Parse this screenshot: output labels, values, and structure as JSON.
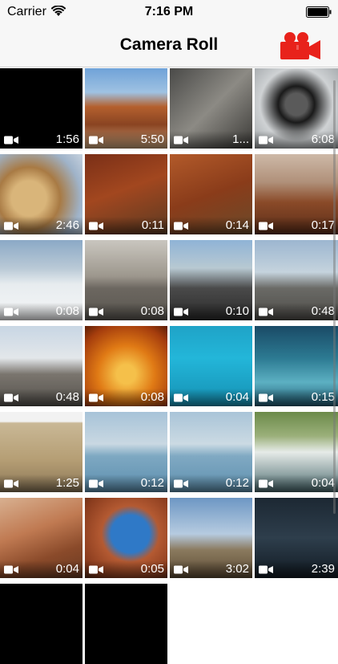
{
  "status_bar": {
    "carrier": "Carrier",
    "time": "7:16 PM"
  },
  "nav": {
    "title": "Camera Roll",
    "accent": "#e8221b"
  },
  "videos": [
    {
      "duration": "1:56",
      "bg": "#000000"
    },
    {
      "duration": "5:50",
      "bg": "linear-gradient(180deg,#6fa2d8 0%,#9fc2e2 30%,#b4602e 48%,#8a4422 70%,#caa27a 100%)"
    },
    {
      "duration": "1...",
      "bg": "linear-gradient(135deg,#4a4a48,#8c8a84 50%,#3a3936)"
    },
    {
      "duration": "6:08",
      "bg": "radial-gradient(circle at 50% 45%,#5a5a5a 0 18%,#1a1a1a 30%,#cfd2d4 60%,#9ea3a6 100%)"
    },
    {
      "duration": "2:46",
      "bg": "radial-gradient(circle at 35% 55%,#d9b57a 0 25%,#a87a44 45%,#9fb3c9 75%,#c6d2df 100%)"
    },
    {
      "duration": "0:11",
      "bg": "linear-gradient(160deg,#7a2f17,#a2471f 45%,#5b3a22 100%)"
    },
    {
      "duration": "0:14",
      "bg": "linear-gradient(160deg,#b25a2a,#8a3c1a 50%,#6a4a2a 100%)"
    },
    {
      "duration": "0:17",
      "bg": "linear-gradient(180deg,#cdb9a8 0%,#b09079 35%,#8a4a28 60%,#5a2c18 100%)"
    },
    {
      "duration": "0:08",
      "bg": "linear-gradient(180deg,#8ba9c6 0%,#b9c9d6 35%,#e7ecef 55%,#f5f6f7 100%)"
    },
    {
      "duration": "0:08",
      "bg": "linear-gradient(180deg,#c9c6bf 0%,#9d978d 45%,#6c6760 60%,#5a5650 100%)"
    },
    {
      "duration": "0:10",
      "bg": "linear-gradient(180deg,#8fb3d6 0%,#b8c9d2 35%,#4a4a4a 60%,#2a2a2a 100%)"
    },
    {
      "duration": "0:48",
      "bg": "linear-gradient(180deg,#9cb6d0 0%,#c5d3dd 40%,#6a6a66 60%,#4e4c48 100%)"
    },
    {
      "duration": "0:48",
      "bg": "linear-gradient(180deg,#c8d6e4 0%,#e3e7ea 40%,#7a756e 60%,#55524d 100%)"
    },
    {
      "duration": "0:08",
      "bg": "radial-gradient(circle at 50% 60%,#f5c04a 0 15%,#e07a15 45%,#a53d0d 80%,#5a1e06 100%)"
    },
    {
      "duration": "0:04",
      "bg": "linear-gradient(180deg,#1fa3c7 0%,#23b6d9 40%,#1590b3 100%)"
    },
    {
      "duration": "0:15",
      "bg": "linear-gradient(180deg,#1a4a66 0%,#2c7a92 40%,#5cb0c2 70%,#1f5a72 100%)"
    },
    {
      "duration": "1:25",
      "bg": "linear-gradient(180deg,#f2f2f2 0%,#f2f2f2 12%,#c9b896 14%,#b59e74 60%,#8a7656 100%)"
    },
    {
      "duration": "0:12",
      "bg": "linear-gradient(180deg,#a7c3d8 0%,#c9d8e2 40%,#7ea8c2 55%,#5c8fae 100%)"
    },
    {
      "duration": "0:12",
      "bg": "linear-gradient(180deg,#a9c4d8 0%,#cbdae3 40%,#80a9c3 55%,#5e90ae 100%)"
    },
    {
      "duration": "0:04",
      "bg": "linear-gradient(180deg,#6b8a4a 0%,#9bb07a 30%,#e6ebe8 50%,#4a6a6e 100%)"
    },
    {
      "duration": "0:04",
      "bg": "linear-gradient(160deg,#d8b090,#c07a52 40%,#8a4a2a 70%,#6a3a22 100%)"
    },
    {
      "duration": "0:05",
      "bg": "radial-gradient(ellipse at 55% 45%,#2f79c7 0 30%,#b45a32 45%,#8a3c1e 80%,#5a2a16 100%)"
    },
    {
      "duration": "3:02",
      "bg": "linear-gradient(180deg,#6d97c4 0%,#b6cbe0 45%,#8a7a5e 65%,#5c4a34 100%)"
    },
    {
      "duration": "2:39",
      "bg": "linear-gradient(180deg,#1c2833 0%,#2e3e4c 50%,#111a22 100%)"
    },
    {
      "duration": "",
      "bg": "#000000"
    },
    {
      "duration": "",
      "bg": "#000000"
    }
  ]
}
